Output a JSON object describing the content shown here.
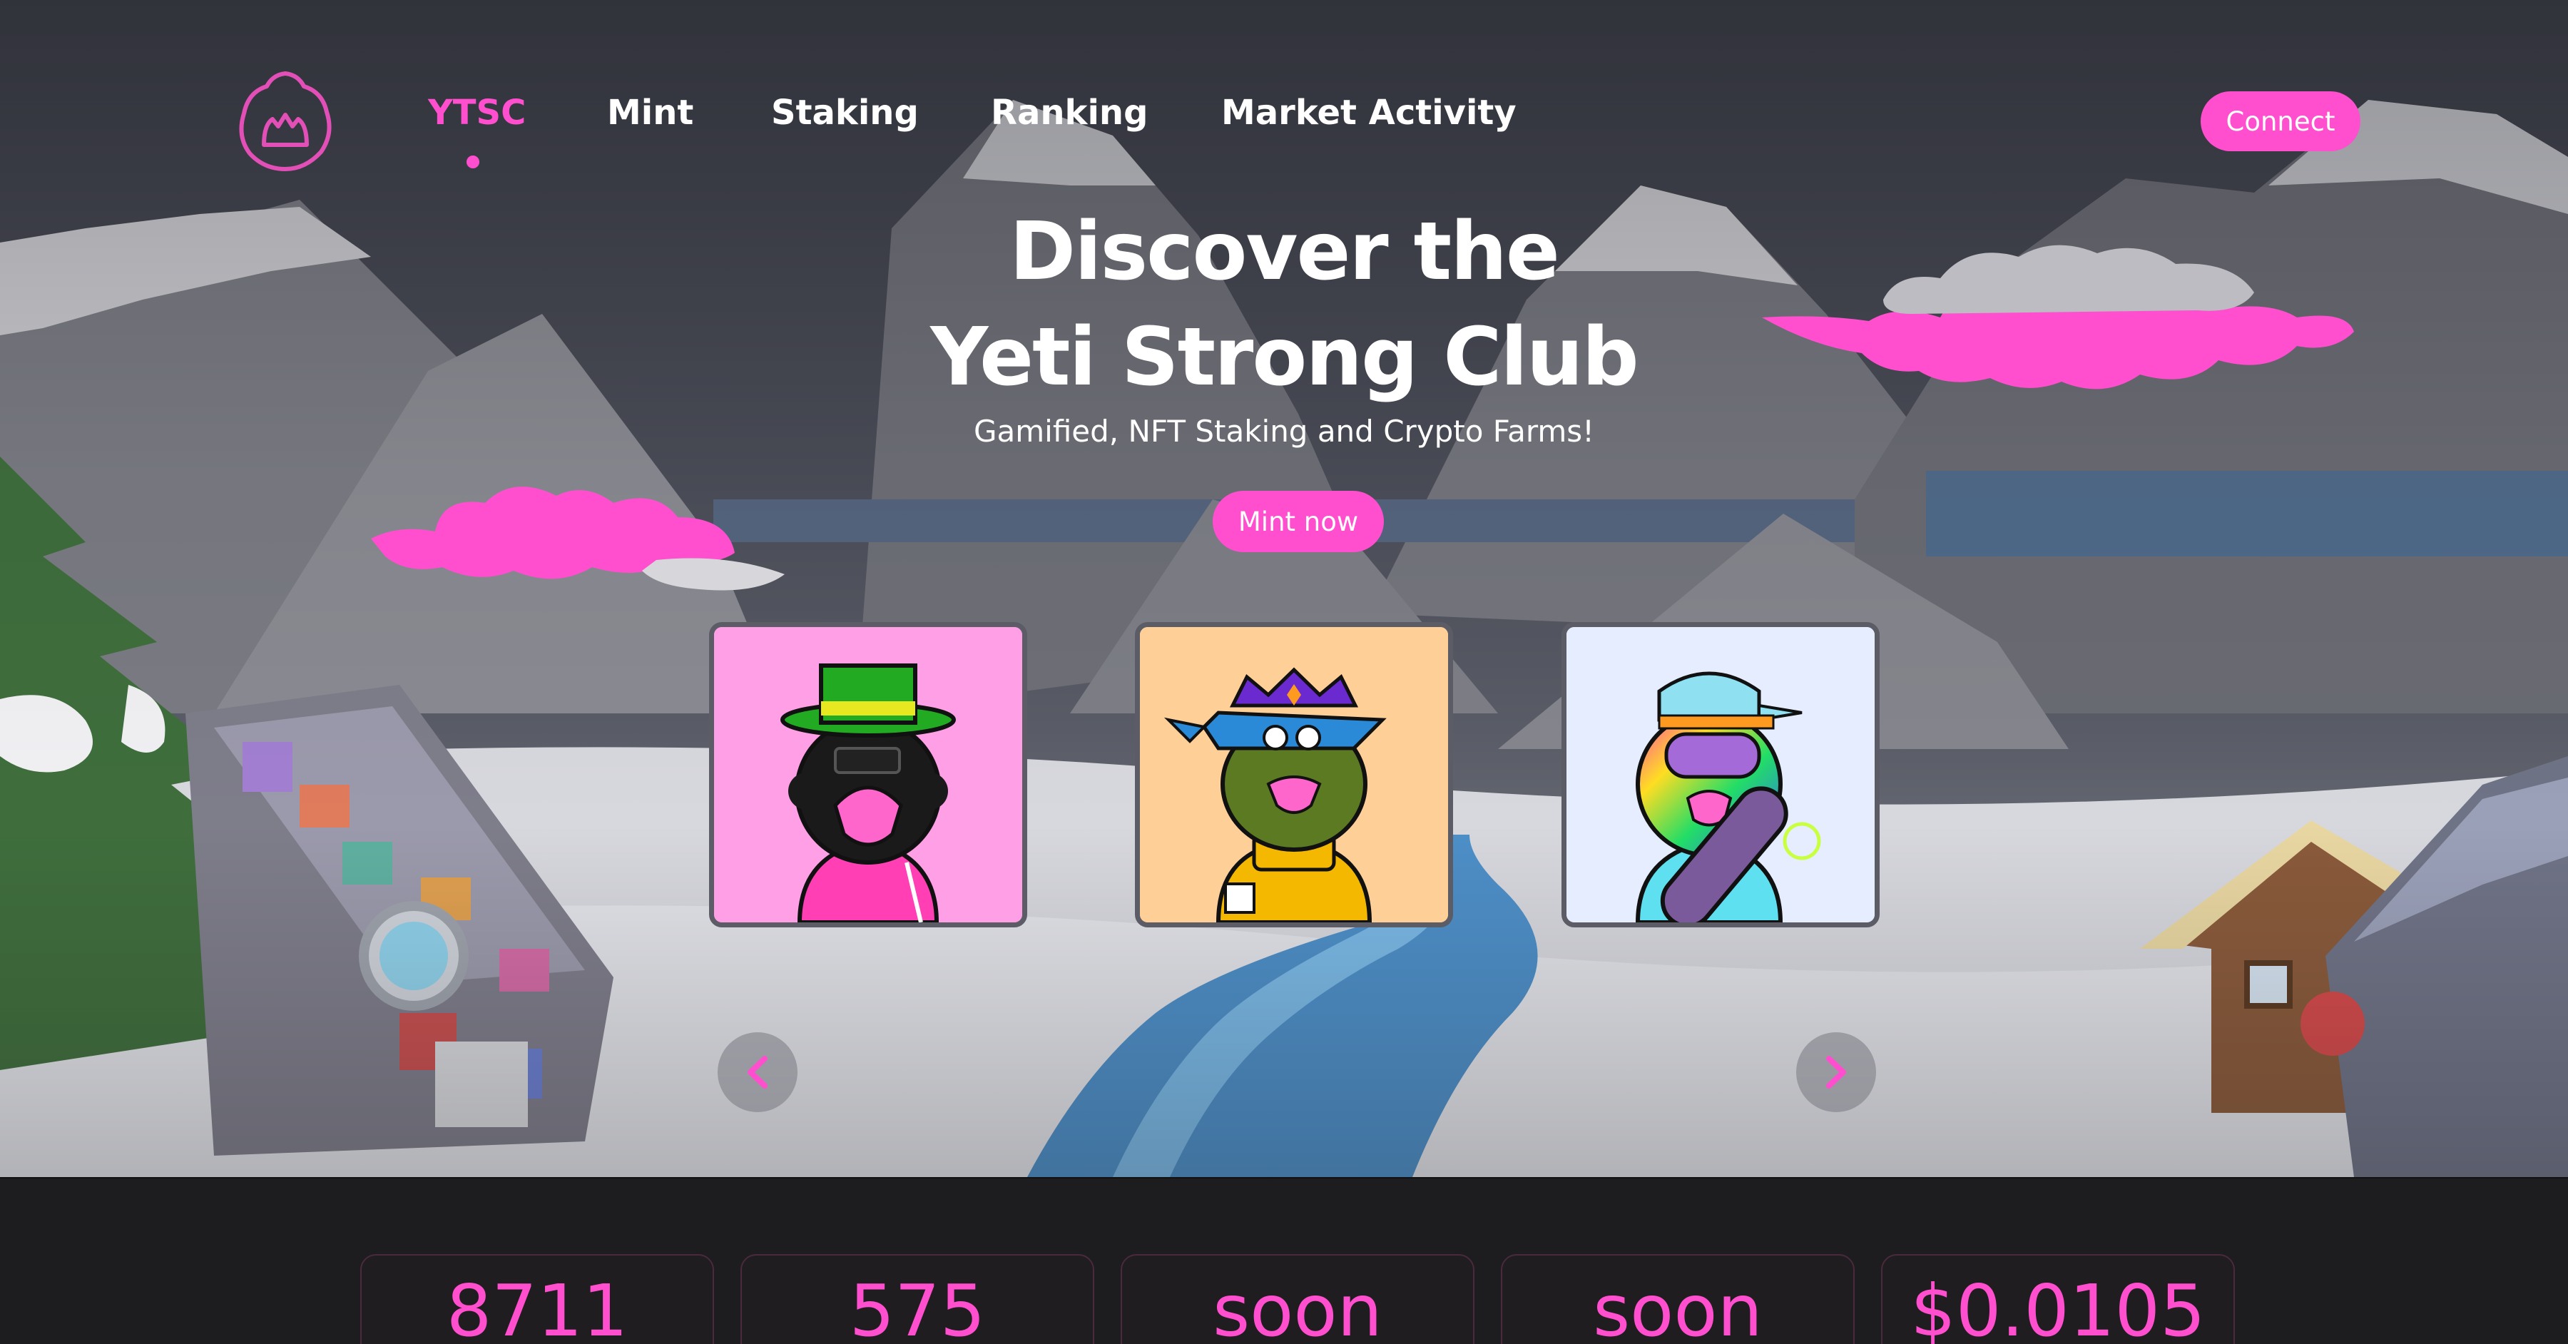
{
  "brand": {
    "accent": "#ff4fcf",
    "logo_icon": "yeti-logo-icon"
  },
  "nav": {
    "items": [
      {
        "label": "YTSC",
        "active": true
      },
      {
        "label": "Mint",
        "active": false
      },
      {
        "label": "Staking",
        "active": false
      },
      {
        "label": "Ranking",
        "active": false
      },
      {
        "label": "Market Activity",
        "active": false
      }
    ],
    "connect_label": "Connect"
  },
  "hero": {
    "title_line1": "Discover the",
    "title_line2": "Yeti Strong Club",
    "subtitle": "Gamified, NFT Staking and Crypto Farms!",
    "cta_label": "Mint now"
  },
  "carousel": {
    "prev_icon": "chevron-left-icon",
    "next_icon": "chevron-right-icon",
    "cards": [
      {
        "icon": "yeti-nft-top-hat-icon",
        "bg": "#ff9fe6"
      },
      {
        "icon": "yeti-nft-crown-icon",
        "bg": "#ffcf98"
      },
      {
        "icon": "yeti-nft-snowboard-icon",
        "bg": "#e6edff"
      }
    ]
  },
  "stats": [
    {
      "value": "8711"
    },
    {
      "value": "575"
    },
    {
      "value": "soon"
    },
    {
      "value": "soon"
    },
    {
      "value": "$0.0105"
    }
  ]
}
